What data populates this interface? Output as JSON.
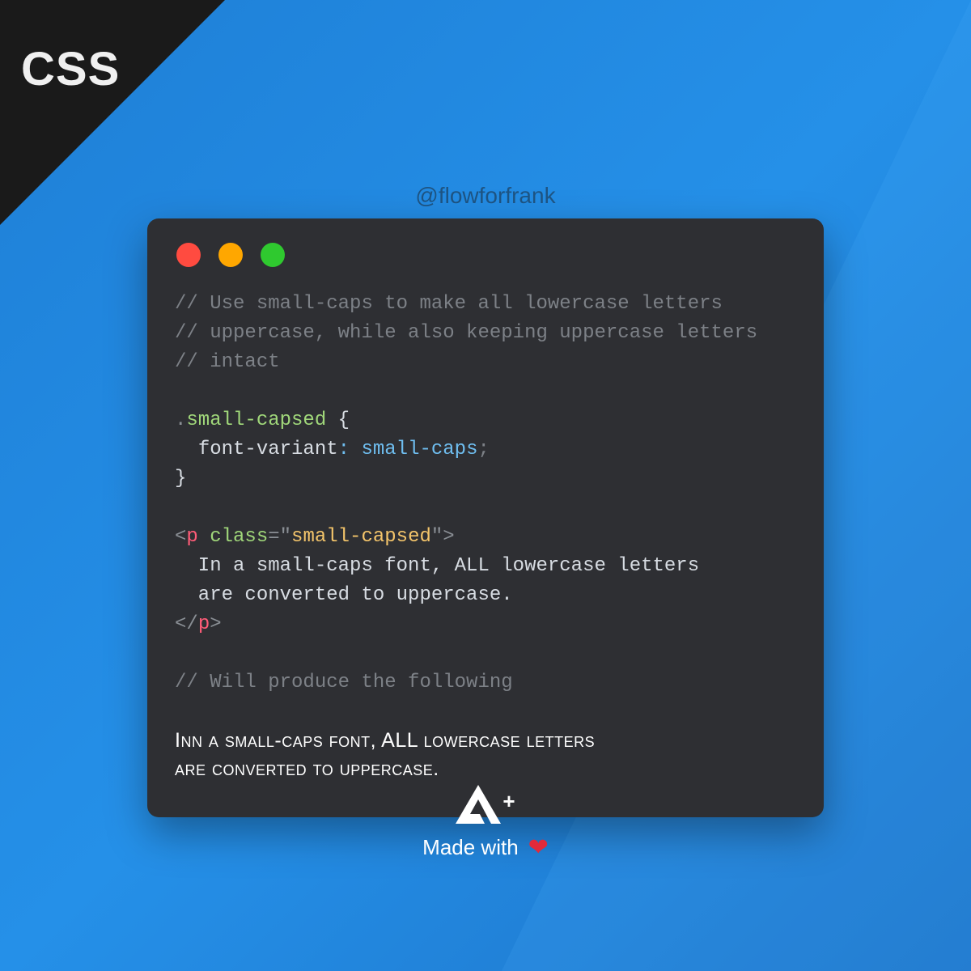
{
  "header": {
    "corner_label": "CSS"
  },
  "handle": "@flowforfrank",
  "code": {
    "comment_l1": "// Use small-caps to make all lowercase letters",
    "comment_l2": "// uppercase, while also keeping uppercase letters",
    "comment_l3": "// intact",
    "selector_dot": ".",
    "selector_name": "small-capsed",
    "brace_open": " {",
    "prop_indent": "  ",
    "prop_name": "font-variant",
    "colon": ": ",
    "prop_value": "small-caps",
    "semicolon": ";",
    "brace_close": "}",
    "lt": "<",
    "tag_p": "p",
    "space": " ",
    "attr_class": "class",
    "eq": "=",
    "q_open": "\"",
    "attr_value": "small-capsed",
    "q_close": "\"",
    "gt": ">",
    "html_text_l1": "  In a small-caps font, ALL lowercase letters",
    "html_text_l2": "  are converted to uppercase.",
    "slash": "/",
    "comment_l4": "// Will produce the following"
  },
  "output": {
    "line1": "Inn a small-caps font, ALL lowercase letters",
    "line2": "are converted to uppercase."
  },
  "footer": {
    "logo_plus": "+",
    "made_with": "Made with"
  },
  "colors": {
    "bg_blue": "#2590e8",
    "card": "#2e2f33",
    "comment": "#7d8187",
    "class": "#a0d77a",
    "value": "#6fbef0",
    "tag": "#ff5c78",
    "string": "#f4c56b",
    "heart": "#e22a3a"
  }
}
